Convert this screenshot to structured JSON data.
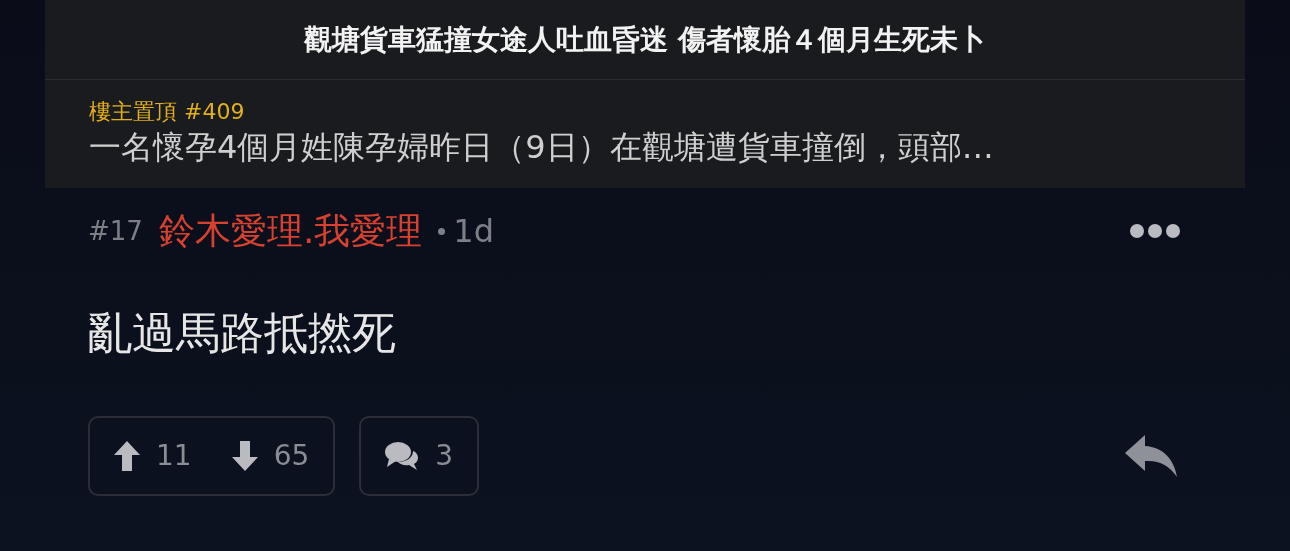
{
  "thread": {
    "title": "觀塘貨車猛撞女途人吐血昏迷 傷者懷胎４個月生死未卜"
  },
  "pinned": {
    "label": "樓主置頂 #409",
    "snippet": "一名懷孕4個月姓陳孕婦昨日（9日）在觀塘遭貨車撞倒，頭部…"
  },
  "comment": {
    "floor": "#17",
    "author": "鈴木愛理.我愛理",
    "time": "1d",
    "body": "亂過馬路抵撚死",
    "upvotes": "11",
    "downvotes": "65",
    "replies": "3"
  }
}
